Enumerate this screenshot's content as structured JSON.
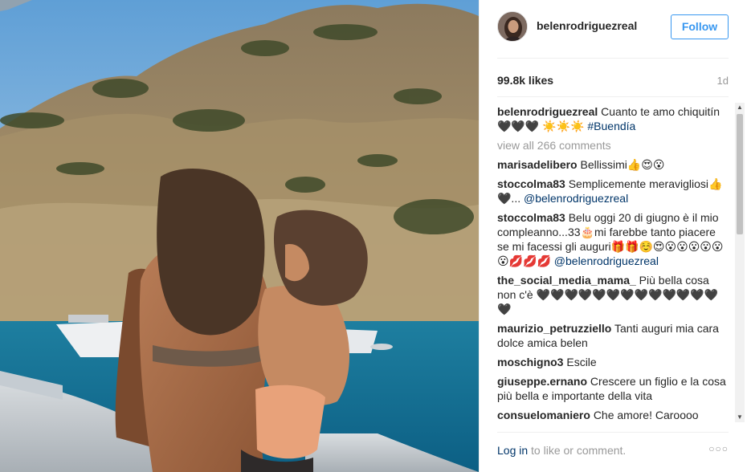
{
  "post": {
    "username": "belenrodriguezreal",
    "follow_label": "Follow",
    "likes": "99.8k likes",
    "time": "1d"
  },
  "caption": {
    "user": "belenrodriguezreal",
    "text": "Cuanto te amo chiquitín 🖤🖤🖤 ☀️☀️☀️",
    "hashtag": "#Buendía"
  },
  "view_all": "view all 266 comments",
  "comments": [
    {
      "user": "marisadelibero",
      "text": "Bellissimi👍😍😮",
      "mention": ""
    },
    {
      "user": "stoccolma83",
      "text": "Semplicemente meravigliosi👍🖤...",
      "mention": "@belenrodriguezreal"
    },
    {
      "user": "stoccolma83",
      "text": "Belu oggi 20 di giugno è il mio compleanno...33🎂mi farebbe tanto piacere se mi facessi gli auguri🎁🎁☺️😍😮😮😮😮😮😮💋💋💋",
      "mention": "@belenrodriguezreal"
    },
    {
      "user": "the_social_media_mama_",
      "text": "Più bella cosa non c'è 🖤🖤🖤🖤🖤🖤🖤🖤🖤🖤🖤🖤🖤🖤",
      "mention": ""
    },
    {
      "user": "maurizio_petruzziello",
      "text": "Tanti auguri mia cara dolce amica belen",
      "mention": ""
    },
    {
      "user": "moschigno3",
      "text": "Escile",
      "mention": ""
    },
    {
      "user": "giuseppe.ernano",
      "text": "Crescere un figlio e la cosa più bella e importante della vita",
      "mention": ""
    },
    {
      "user": "consuelomaniero",
      "text": "Che amore! Caroooo",
      "mention": ""
    }
  ],
  "footer": {
    "login_link": "Log in",
    "login_rest": " to like or comment.",
    "more_icon": "more-horizontal-icon"
  },
  "colors": {
    "accent": "#3897f0",
    "link": "#003569",
    "muted": "#999999",
    "text": "#262626"
  }
}
